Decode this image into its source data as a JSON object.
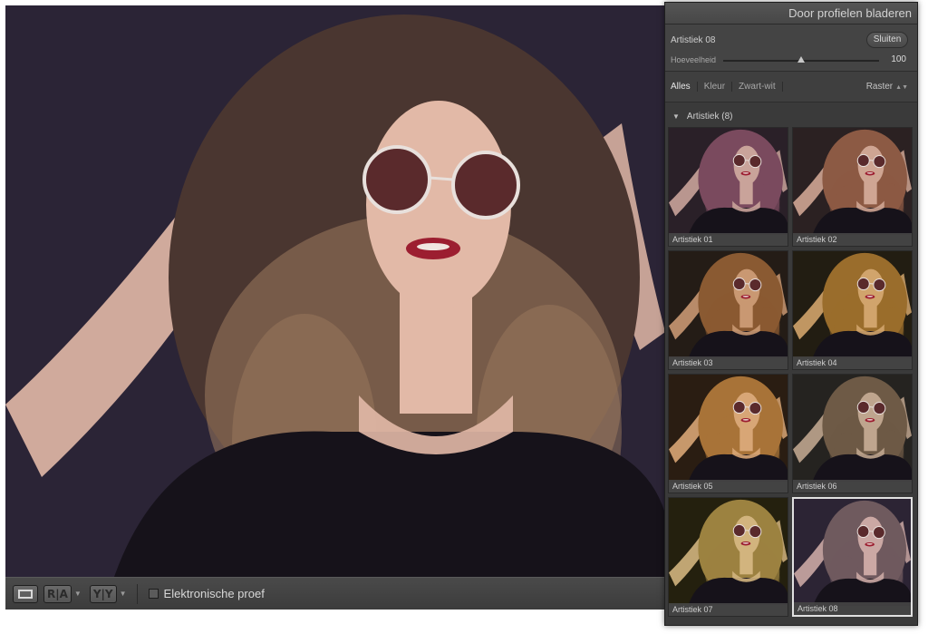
{
  "panel": {
    "title": "Door profielen bladeren",
    "profile_name": "Artistiek 08",
    "close_label": "Sluiten",
    "amount_label": "Hoeveelheid",
    "amount_value": "100",
    "amount_fraction": 0.5,
    "filters": [
      "Alles",
      "Kleur",
      "Zwart-wit"
    ],
    "active_filter": "Alles",
    "view_label": "Raster",
    "group_label": "Artistiek (8)",
    "thumbnails": [
      {
        "label": "Artistiek 01",
        "bg": "#2a2028",
        "hair": "#7a4a5e",
        "skin": "#c9a39a"
      },
      {
        "label": "Artistiek 02",
        "bg": "#2b2122",
        "hair": "#8c5a44",
        "skin": "#cfa593"
      },
      {
        "label": "Artistiek 03",
        "bg": "#241c16",
        "hair": "#8a5a32",
        "skin": "#c99872"
      },
      {
        "label": "Artistiek 04",
        "bg": "#221d12",
        "hair": "#9a6d2c",
        "skin": "#d1a46c"
      },
      {
        "label": "Artistiek 05",
        "bg": "#2a1d12",
        "hair": "#a87338",
        "skin": "#d8a676"
      },
      {
        "label": "Artistiek 06",
        "bg": "#252320",
        "hair": "#6e5a46",
        "skin": "#bfa58e"
      },
      {
        "label": "Artistiek 07",
        "bg": "#24200e",
        "hair": "#9c8240",
        "skin": "#d2b47e"
      },
      {
        "label": "Artistiek 08",
        "bg": "#2c2434",
        "hair": "#6f5a5e",
        "skin": "#cba8a4"
      }
    ],
    "selected_index": 7
  },
  "toolbar": {
    "view_single_icon": "loupe-view-icon",
    "before_after_left_right": "R|A",
    "before_after_top_bottom": "Y|Y",
    "softproof_label": "Elektronische proef"
  },
  "colors": {
    "photo_bg": "#2b2436",
    "hair_main": "#4a3630",
    "hair_light": "#9c7a5e",
    "skin": "#e2b9a7",
    "lips": "#9c1e30",
    "lens": "#5a2a2c"
  }
}
